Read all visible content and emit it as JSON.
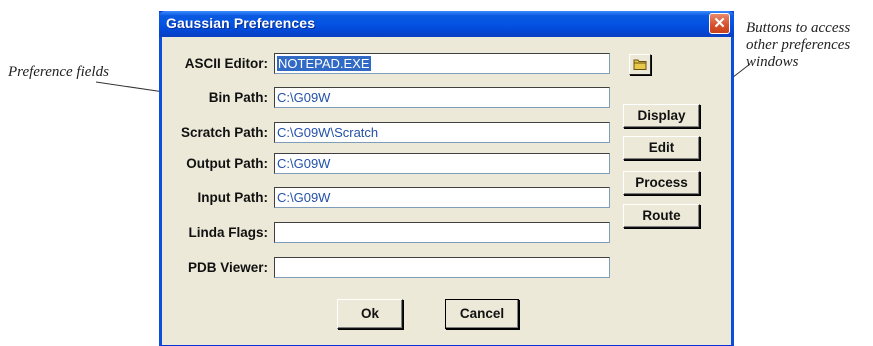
{
  "annotations": {
    "left": "Preference fields",
    "right_line1": "Buttons to access",
    "right_line2": "other preferences",
    "right_line3": "windows"
  },
  "dialog": {
    "title": "Gaussian Preferences",
    "close_glyph": "✕"
  },
  "fields": [
    {
      "label": "ASCII Editor:",
      "value": "NOTEPAD.EXE"
    },
    {
      "label": "Bin Path:",
      "value": "C:\\G09W"
    },
    {
      "label": "Scratch Path:",
      "value": "C:\\G09W\\Scratch"
    },
    {
      "label": "Output Path:",
      "value": "C:\\G09W"
    },
    {
      "label": "Input Path:",
      "value": "C:\\G09W"
    },
    {
      "label": "Linda Flags:",
      "value": ""
    },
    {
      "label": "PDB Viewer:",
      "value": ""
    }
  ],
  "side_buttons": {
    "display": "Display",
    "edit": "Edit",
    "process": "Process",
    "route": "Route"
  },
  "bottom_buttons": {
    "ok": "Ok",
    "cancel": "Cancel"
  },
  "icons": {
    "browse": "folder-icon",
    "close": "close-icon"
  }
}
